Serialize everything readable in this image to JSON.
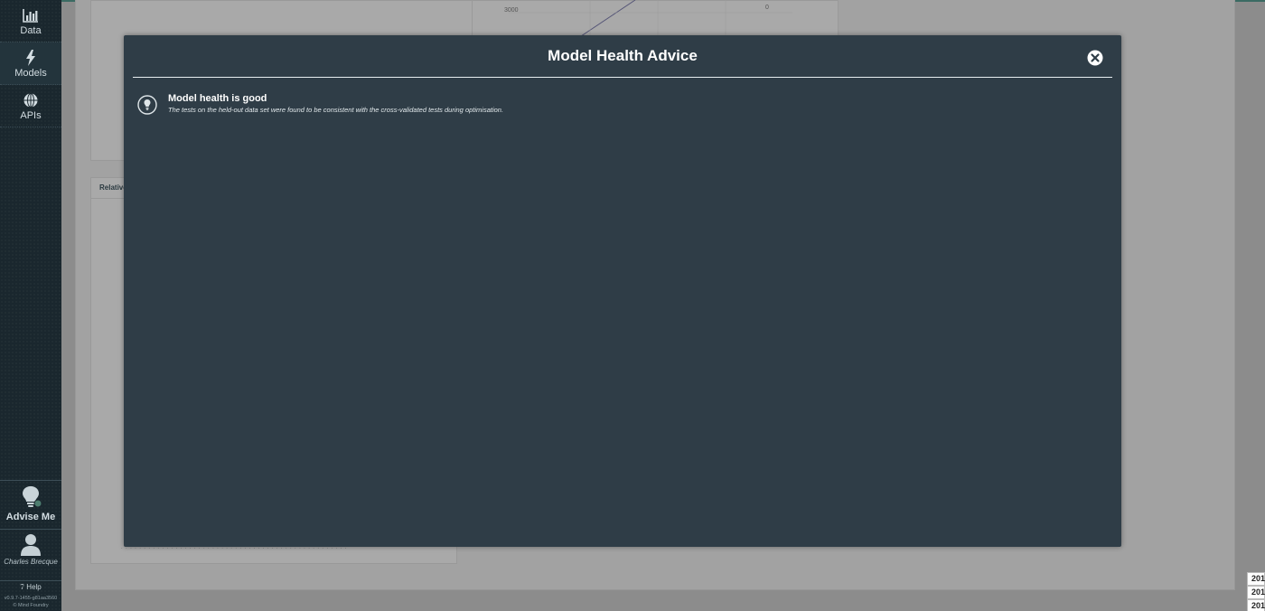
{
  "sidebar": {
    "items": [
      {
        "label": "Data",
        "icon": "bar-chart-icon"
      },
      {
        "label": "Models",
        "icon": "lightning-icon"
      },
      {
        "label": "APIs",
        "icon": "globe-icon"
      }
    ],
    "advise_label": "Advise Me",
    "user_name": "Charles Brecque",
    "help_label": "Help",
    "version_line1": "v0.9.7-1455-g81aa3560",
    "version_line2": "© Mind Foundry"
  },
  "background": {
    "tick_y": "3000",
    "tick_x": "0",
    "card_title": "Relative",
    "table_rows": [
      "201",
      "201",
      "201"
    ]
  },
  "modal": {
    "title": "Model Health Advice",
    "advice_title": "Model health is good",
    "advice_text": "The tests on the held-out data set were found to be consistent with the cross-validated tests during optimisation."
  },
  "colors": {
    "sidebar_bg": "#1a272e",
    "modal_bg": "#2f3d47",
    "overlay": "#8c8c8c"
  }
}
